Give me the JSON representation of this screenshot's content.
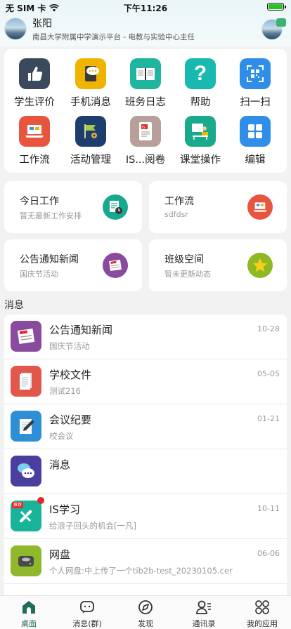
{
  "status": {
    "carrier": "无 SIM 卡",
    "time": "下午11:26"
  },
  "user": {
    "name": "张阳",
    "org": "南昌大学附属中学演示平台 - 电教与实验中心主任"
  },
  "apps": [
    {
      "label": "学生评价",
      "icon": "thumbs-up-icon",
      "color": "#3a4a5c"
    },
    {
      "label": "手机消息",
      "icon": "chat-bubble-icon",
      "color": "#f0b400"
    },
    {
      "label": "班务日志",
      "icon": "open-book-icon",
      "color": "#1fb59e"
    },
    {
      "label": "帮助",
      "icon": "question-icon",
      "color": "#17b9b0"
    },
    {
      "label": "扫一扫",
      "icon": "qr-scan-icon",
      "color": "#2f8fe8"
    },
    {
      "label": "工作流",
      "icon": "laptop-icon",
      "color": "#e8553f"
    },
    {
      "label": "活动管理",
      "icon": "flag-gear-icon",
      "color": "#1e3f6e"
    },
    {
      "label": "IS...阅卷",
      "icon": "exam-paper-icon",
      "color": "#b8a09a"
    },
    {
      "label": "课堂操作",
      "icon": "teacher-desk-icon",
      "color": "#19a98d"
    },
    {
      "label": "编辑",
      "icon": "grid-icon",
      "color": "#2f8fe8"
    }
  ],
  "tiles": [
    {
      "title": "今日工作",
      "sub": "暂无最新工作安排",
      "icon": "calendar-clock-icon",
      "color": "#17a98f"
    },
    {
      "title": "工作流",
      "sub": "sdfdsr",
      "icon": "laptop-icon",
      "color": "#e8553f"
    },
    {
      "title": "公告通知新闻",
      "sub": "国庆节活动",
      "icon": "news-icon",
      "color": "#8a4a9e"
    },
    {
      "title": "班级空间",
      "sub": "暂未更新动态",
      "icon": "star-icon",
      "color": "#8fb822"
    }
  ],
  "section_label": "消息",
  "messages": [
    {
      "title": "公告通知新闻",
      "sub": "国庆节活动",
      "date": "10-28",
      "icon": "news-icon",
      "color": "#8a4a9e"
    },
    {
      "title": "学校文件",
      "sub": "测试216",
      "date": "05-05",
      "icon": "document-icon",
      "color": "#e2574c"
    },
    {
      "title": "会议纪要",
      "sub": "校会议",
      "date": "01-21",
      "icon": "notepad-pen-icon",
      "color": "#2f8fd6"
    },
    {
      "title": "消息",
      "sub": "",
      "date": "",
      "icon": "chat-bubbles-icon",
      "color": "#4a3f9e"
    },
    {
      "title": "IS学习",
      "sub": "给浪子回头的机会[一凡]",
      "date": "10-11",
      "icon": "pencil-ruler-icon",
      "color": "#19b39a",
      "ribbon": "推荐"
    },
    {
      "title": "网盘",
      "sub": "个人网盘:中上传了一个tib2b-test_20230105.cer",
      "date": "06-06",
      "icon": "hard-drive-icon",
      "color": "#8fb82a"
    }
  ],
  "tabs": [
    {
      "label": "桌面",
      "icon": "home-icon"
    },
    {
      "label": "消息(群)",
      "icon": "chat-icon"
    },
    {
      "label": "发现",
      "icon": "compass-icon"
    },
    {
      "label": "通讯录",
      "icon": "contacts-icon"
    },
    {
      "label": "我的应用",
      "icon": "apps-icon"
    }
  ]
}
